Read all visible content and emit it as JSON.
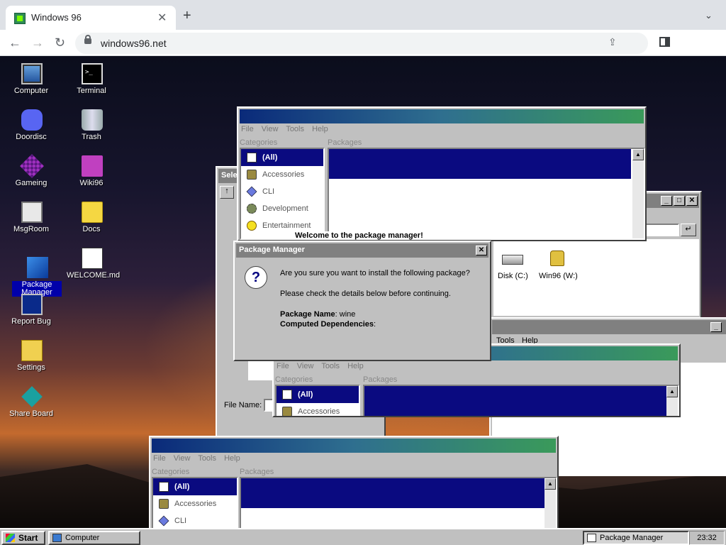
{
  "browser": {
    "tab_title": "Windows 96",
    "close_symbol": "✕",
    "new_tab_symbol": "+",
    "tab_menu_symbol": "⌄",
    "url": "windows96.net",
    "back_symbol": "←",
    "forward_symbol": "→",
    "reload_symbol": "↻",
    "share_symbol": "⇪"
  },
  "desktop": {
    "icons": [
      {
        "label": "Computer",
        "icon": "computer-icon"
      },
      {
        "label": "Terminal",
        "icon": "terminal-icon"
      },
      {
        "label": "Doordisc",
        "icon": "doordisc-icon"
      },
      {
        "label": "Trash",
        "icon": "trash-icon"
      },
      {
        "label": "Gameing",
        "icon": "gameing-icon"
      },
      {
        "label": "Wiki96",
        "icon": "wiki-icon"
      },
      {
        "label": "MsgRoom",
        "icon": "msgroom-icon"
      },
      {
        "label": "Docs",
        "icon": "folder-icon"
      },
      {
        "label": "Package Manager",
        "icon": "package-manager-icon"
      },
      {
        "label": "WELCOME.md",
        "icon": "markdown-file-icon"
      },
      {
        "label": "Report Bug",
        "icon": "report-bug-icon"
      },
      {
        "label": "Settings",
        "icon": "settings-icon"
      },
      {
        "label": "Share Board",
        "icon": "share-board-icon"
      }
    ]
  },
  "pkgmgr": {
    "menu": [
      "File",
      "View",
      "Tools",
      "Help"
    ],
    "categories_label": "Categories",
    "packages_label": "Packages",
    "categories": [
      "(All)",
      "Accessories",
      "CLI",
      "Development",
      "Entertainment"
    ]
  },
  "background_windows": {
    "select_title": "Sele",
    "welcome_text": "Welcome to the package manager!",
    "file_name_label": "File Name:",
    "disk_c": "Disk (C:)",
    "disk_w": "Win96 (W:)",
    "menu_tools": "Tools",
    "menu_help": "Help",
    "up_arrow": "↑",
    "enter_arrow": "↵"
  },
  "dialog": {
    "title": "Package Manager",
    "close": "✕",
    "question_mark": "?",
    "line1": "Are you sure you want to install the following package?",
    "line2": "Please check the details below before continuing.",
    "package_name_label": "Package Name",
    "package_name_value": ": wine",
    "deps_label": "Computed Dependencies",
    "deps_value": ":"
  },
  "window_buttons": {
    "min": "_",
    "max": "□",
    "close": "✕"
  },
  "scroll_up": "▲",
  "taskbar": {
    "start": "Start",
    "items": [
      "Computer",
      "Package Manager"
    ],
    "clock": "23:32"
  }
}
